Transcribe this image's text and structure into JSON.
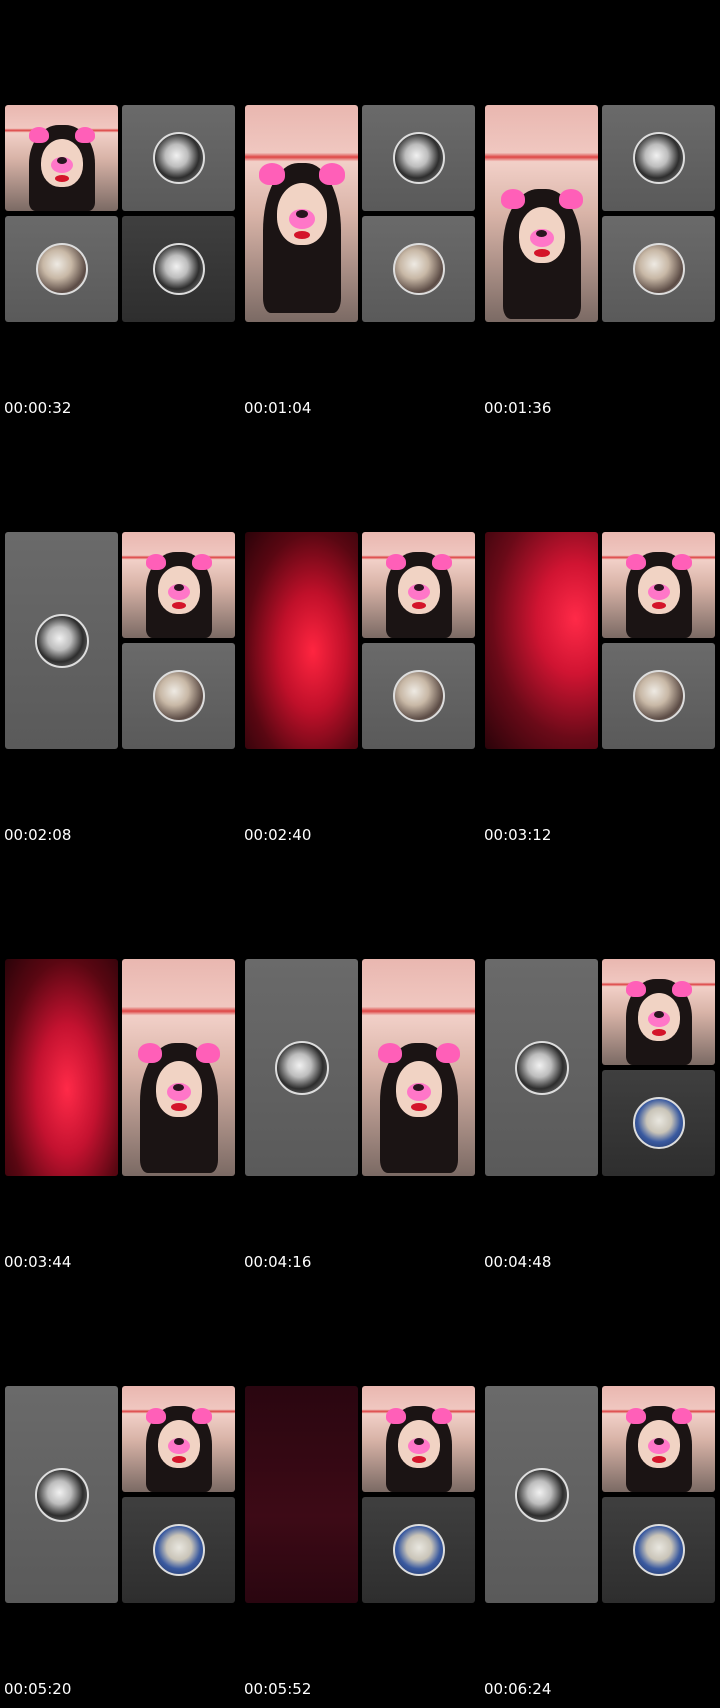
{
  "frames": [
    {
      "timestamp": "00:00:32"
    },
    {
      "timestamp": "00:01:04"
    },
    {
      "timestamp": "00:01:36"
    },
    {
      "timestamp": "00:02:08"
    },
    {
      "timestamp": "00:02:40"
    },
    {
      "timestamp": "00:03:12"
    },
    {
      "timestamp": "00:03:44"
    },
    {
      "timestamp": "00:04:16"
    },
    {
      "timestamp": "00:04:48"
    },
    {
      "timestamp": "00:05:20"
    },
    {
      "timestamp": "00:05:52"
    },
    {
      "timestamp": "00:06:24"
    }
  ],
  "colors": {
    "background": "#000000",
    "tile_gray": "#6a6a6a",
    "tile_dark": "#333333",
    "red_light": "#ff2540",
    "filter_pink": "#ff5fb8"
  }
}
